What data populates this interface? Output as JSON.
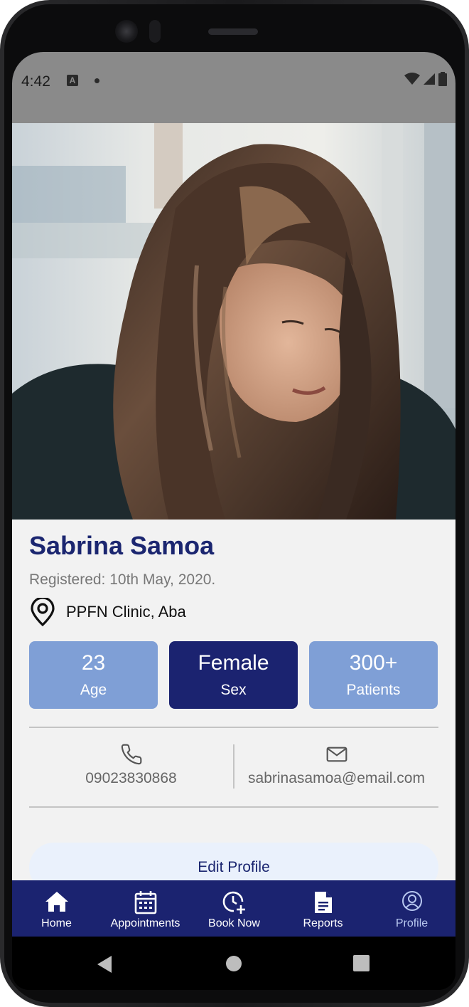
{
  "status_bar": {
    "time": "4:42",
    "notification_icon": "A",
    "icons": [
      "wifi-icon",
      "signal-icon",
      "battery-icon"
    ]
  },
  "profile": {
    "photo": "profile-photo",
    "name": "Sabrina Samoa",
    "registered": "Registered: 10th May, 2020.",
    "location": "PPFN Clinic, Aba",
    "stats": [
      {
        "value": "23",
        "label": "Age"
      },
      {
        "value": "Female",
        "label": "Sex"
      },
      {
        "value": "300+",
        "label": "Patients"
      }
    ],
    "phone": "09023830868",
    "email": "sabrinasamoa@email.com",
    "edit_button": "Edit Profile"
  },
  "tabs": [
    {
      "label": "Home",
      "icon": "home-icon"
    },
    {
      "label": "Appointments",
      "icon": "calendar-icon"
    },
    {
      "label": "Book Now",
      "icon": "clock-plus-icon"
    },
    {
      "label": "Reports",
      "icon": "document-icon"
    },
    {
      "label": "Profile",
      "icon": "user-icon",
      "active": true
    }
  ],
  "colors": {
    "primary": "#1b2370",
    "accent": "#7f9fd6",
    "background": "#f2f2f2",
    "status_bar": "#8a8a8a"
  }
}
